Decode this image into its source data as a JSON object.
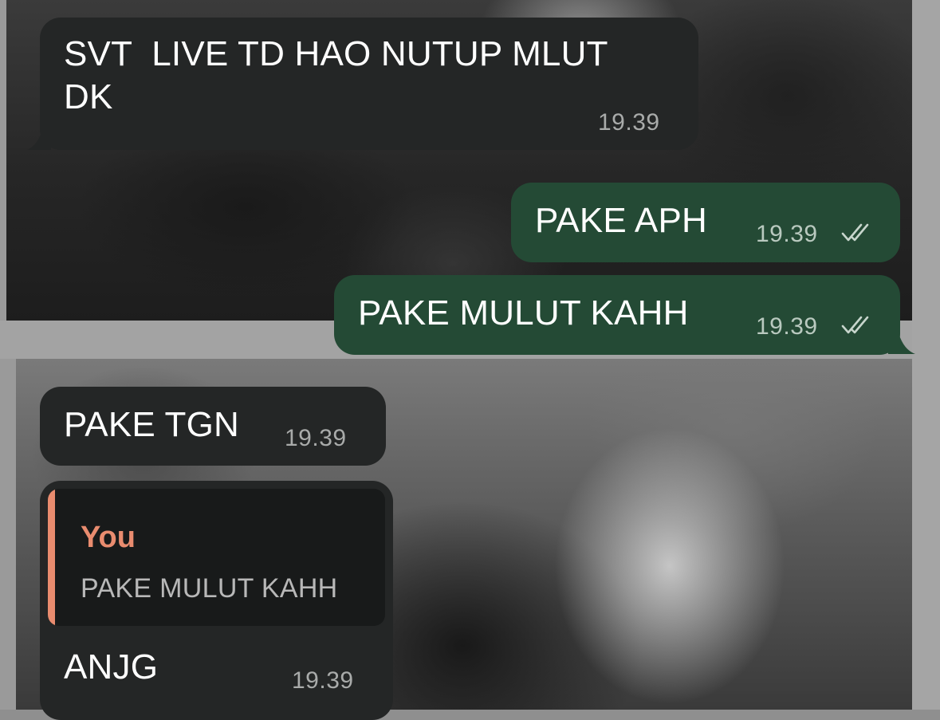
{
  "messages": [
    {
      "direction": "incoming",
      "text": "SVT  LIVE TD HAO NUTUP MLUT\nDK",
      "time": "19.39"
    },
    {
      "direction": "outgoing",
      "text": "PAKE APH",
      "time": "19.39",
      "status_icon": "double-check-icon"
    },
    {
      "direction": "outgoing",
      "text": "PAKE MULUT KAHH",
      "time": "19.39",
      "status_icon": "double-check-icon"
    },
    {
      "direction": "incoming",
      "text": "PAKE TGN",
      "time": "19.39"
    },
    {
      "direction": "incoming",
      "reply_to": {
        "author": "You",
        "text": "PAKE MULUT KAHH"
      },
      "text": "ANJG",
      "time": "19.39"
    }
  ],
  "colors": {
    "incoming_bubble": "#242626",
    "outgoing_bubble": "#244a35",
    "reply_accent": "#e98c6f"
  }
}
